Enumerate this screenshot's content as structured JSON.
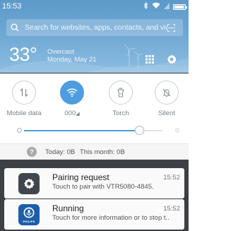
{
  "status_bar": {
    "time": "15:53",
    "icons": [
      "bluetooth-icon",
      "wifi-icon",
      "signal-icon",
      "battery-icon"
    ],
    "battery_level": 0.9
  },
  "search": {
    "placeholder": "Search for websites, apps, contacts, and videos"
  },
  "weather": {
    "temperature": "33°",
    "condition": "Overcast",
    "date": "Monday, May 21"
  },
  "toggles": [
    {
      "label": "Mobile data",
      "icon": "mobile-data-icon",
      "active": false
    },
    {
      "label": "000",
      "icon": "wifi-icon",
      "active": true
    },
    {
      "label": "Torch",
      "icon": "torch-icon",
      "active": false
    },
    {
      "label": "Silent",
      "icon": "bell-off-icon",
      "active": false
    }
  ],
  "brightness": {
    "level": 0.83
  },
  "data_usage": {
    "today": "Today: 0B",
    "month": "This month: 0B"
  },
  "notifications": [
    {
      "app_icon": "settings-gear-icon",
      "title": "Pairing request",
      "body": "Touch to pair with VTR5080-4845.",
      "time": "15:52"
    },
    {
      "app_icon": "philips-app-icon",
      "title": "Running",
      "body": "Touch for more information or to stop t..",
      "time": "15:52",
      "icon_text": "PHILIPS"
    }
  ],
  "colors": {
    "accent": "#4d9de0",
    "header_top": "#5d9ac9",
    "shade": "#3c3f43"
  }
}
